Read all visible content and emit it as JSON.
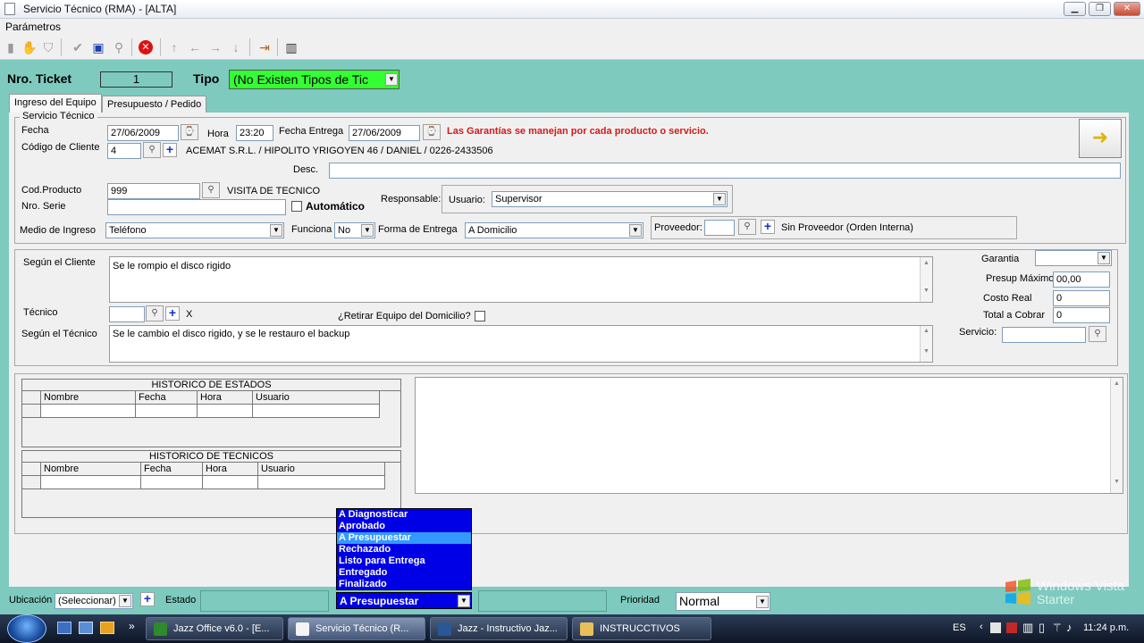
{
  "window": {
    "title": "Servicio Técnico (RMA) - [ALTA]",
    "min": "▁",
    "max": "❐",
    "close": "✕"
  },
  "menu": {
    "parametros": "Parámetros"
  },
  "header": {
    "ticket_label": "Nro. Ticket",
    "ticket_value": "1",
    "tipo_label": "Tipo",
    "tipo_value": "(No Existen Tipos de Tic"
  },
  "tabs": {
    "ingreso": "Ingreso del Equipo",
    "presupuesto": "Presupuesto / Pedido"
  },
  "servicio": {
    "group_label": "Servicio Técnico",
    "fecha_label": "Fecha",
    "fecha_value": "27/06/2009",
    "hora_label": "Hora",
    "hora_value": "23:20",
    "fecha_entrega_label": "Fecha Entrega",
    "fecha_entrega_value": "27/06/2009",
    "warning": "Las Garantías se manejan por cada producto o servicio.",
    "codigo_cliente_label": "Código de Cliente",
    "codigo_cliente_value": "4",
    "cliente_info": "ACEMAT S.R.L. / HIPOLITO YRIGOYEN 46 / DANIEL / 0226-2433506",
    "desc_label": "Desc.",
    "desc_value": "",
    "cod_producto_label": "Cod.Producto",
    "cod_producto_value": "999",
    "producto_name": "VISITA DE TECNICO",
    "nro_serie_label": "Nro. Serie",
    "nro_serie_value": "",
    "automatico_label": "Automático",
    "responsable_label": "Responsable:",
    "usuario_label": "Usuario:",
    "usuario_value": "Supervisor",
    "medio_label": "Medio de Ingreso",
    "medio_value": "Teléfono",
    "funciona_label": "Funciona",
    "funciona_value": "No",
    "forma_entrega_label": "Forma de Entrega",
    "forma_entrega_value": "A Domicilio",
    "proveedor_label": "Proveedor:",
    "proveedor_value": "",
    "proveedor_name": "Sin Proveedor (Orden Interna)"
  },
  "diagnostico": {
    "segun_cliente_label": "Según el Cliente",
    "segun_cliente_value": "Se le rompio el disco rigido",
    "tecnico_label": "Técnico",
    "tecnico_value": "",
    "tecnico_clear": "X",
    "retirar_label": "¿Retirar Equipo del Domicilio?",
    "segun_tecnico_label": "Según el Técnico",
    "segun_tecnico_value": "Se le cambio el disco rigido, y se le restauro el backup",
    "garantia_label": "Garantia",
    "garantia_value": "",
    "presup_max_label": "Presup Máximo",
    "presup_max_value": "00,00",
    "costo_real_label": "Costo Real",
    "costo_real_value": "0",
    "total_cobrar_label": "Total a Cobrar",
    "total_cobrar_value": "0",
    "servicio_label": "Servicio:",
    "servicio_value": ""
  },
  "historico_estados": {
    "title": "HISTORICO DE ESTADOS",
    "columns": [
      "Nombre",
      "Fecha",
      "Hora",
      "Usuario"
    ]
  },
  "historico_tecnicos": {
    "title": "HISTORICO DE TECNICOS",
    "columns": [
      "Nombre",
      "Fecha",
      "Hora",
      "Usuario"
    ]
  },
  "estado_dropdown": {
    "options": [
      "A Diagnosticar",
      "Aprobado",
      "A Presupuestar",
      "Rechazado",
      "Listo para Entrega",
      "Entregado",
      "Finalizado"
    ],
    "selected": "A Presupuestar"
  },
  "bottom": {
    "ubicacion_label": "Ubicación",
    "ubicacion_value": "(Seleccionar)",
    "estado_label": "Estado",
    "estado_value": "A Presupuestar",
    "prioridad_label": "Prioridad",
    "prioridad_value": "Normal"
  },
  "watermark": {
    "line1": "Windows Vista",
    "line2": "Starter"
  },
  "taskbar": {
    "items": [
      "Jazz Office v6.0 - [E...",
      "Servicio Técnico (R...",
      "Jazz - Instructivo Jaz...",
      "INSTRUCCTIVOS"
    ],
    "lang": "ES",
    "clock": "11:24 p.m."
  }
}
